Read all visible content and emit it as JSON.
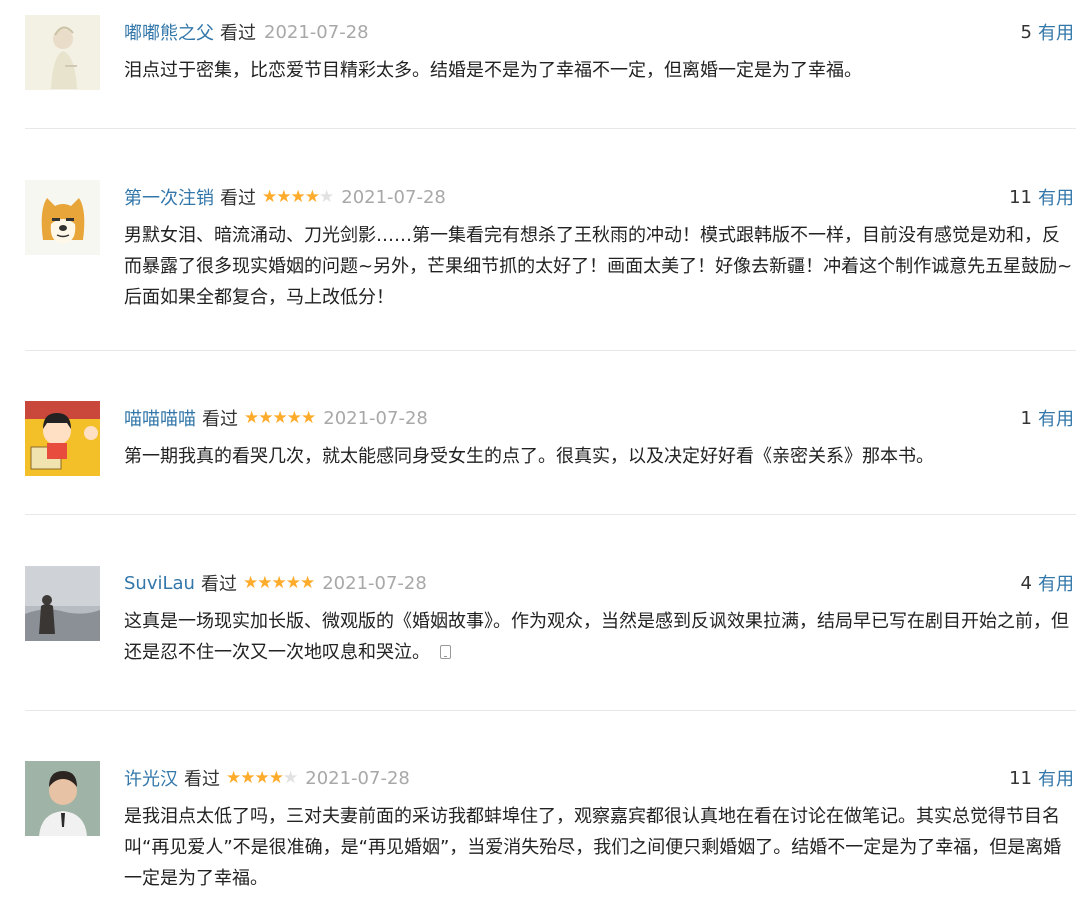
{
  "reviews": [
    {
      "username": "嘟嘟熊之父",
      "status": "看过",
      "rating": 0,
      "date": "2021-07-28",
      "votes": "5",
      "useful_label": "有用",
      "text": "泪点过于密集，比恋爱节目精彩太多。结婚是不是为了幸福不一定，但离婚一定是为了幸福。",
      "avatar": "pale-sketch-figure"
    },
    {
      "username": "第一次注销",
      "status": "看过",
      "rating": 4,
      "date": "2021-07-28",
      "votes": "11",
      "useful_label": "有用",
      "text": "男默女泪、暗流涌动、刀光剑影……第一集看完有想杀了王秋雨的冲动！模式跟韩版不一样，目前没有感觉是劝和，反而暴露了很多现实婚姻的问题~另外，芒果细节抓的太好了！画面太美了！好像去新疆！冲着这个制作诚意先五星鼓励~后面如果全都复合，马上改低分！",
      "avatar": "cartoon-shiba-dog"
    },
    {
      "username": "喵喵喵喵",
      "status": "看过",
      "rating": 5,
      "date": "2021-07-28",
      "votes": "1",
      "useful_label": "有用",
      "text": "第一期我真的看哭几次，就太能感同身受女生的点了。很真实，以及决定好好看《亲密关系》那本书。",
      "avatar": "cartoon-girl-chibi"
    },
    {
      "username": "SuviLau",
      "status": "看过",
      "rating": 5,
      "date": "2021-07-28",
      "votes": "4",
      "useful_label": "有用",
      "text": "这真是一场现实加长版、微观版的《婚姻故事》。作为观众，当然是感到反讽效果拉满，结局早已写在剧目开始之前，但还是忍不住一次又一次地叹息和哭泣。",
      "show_phone_icon": true,
      "avatar": "person-misty-landscape"
    },
    {
      "username": "许光汉",
      "status": "看过",
      "rating": 4,
      "date": "2021-07-28",
      "votes": "11",
      "useful_label": "有用",
      "text": "是我泪点太低了吗，三对夫妻前面的采访我都蚌埠住了，观察嘉宾都很认真地在看在讨论在做笔记。其实总觉得节目名叫“再见爱人”不是很准确，是“再见婚姻”，当爱消失殆尽，我们之间便只剩婚姻了。结婚不一定是为了幸福，但是离婚一定是为了幸福。",
      "avatar": "man-portrait"
    }
  ]
}
